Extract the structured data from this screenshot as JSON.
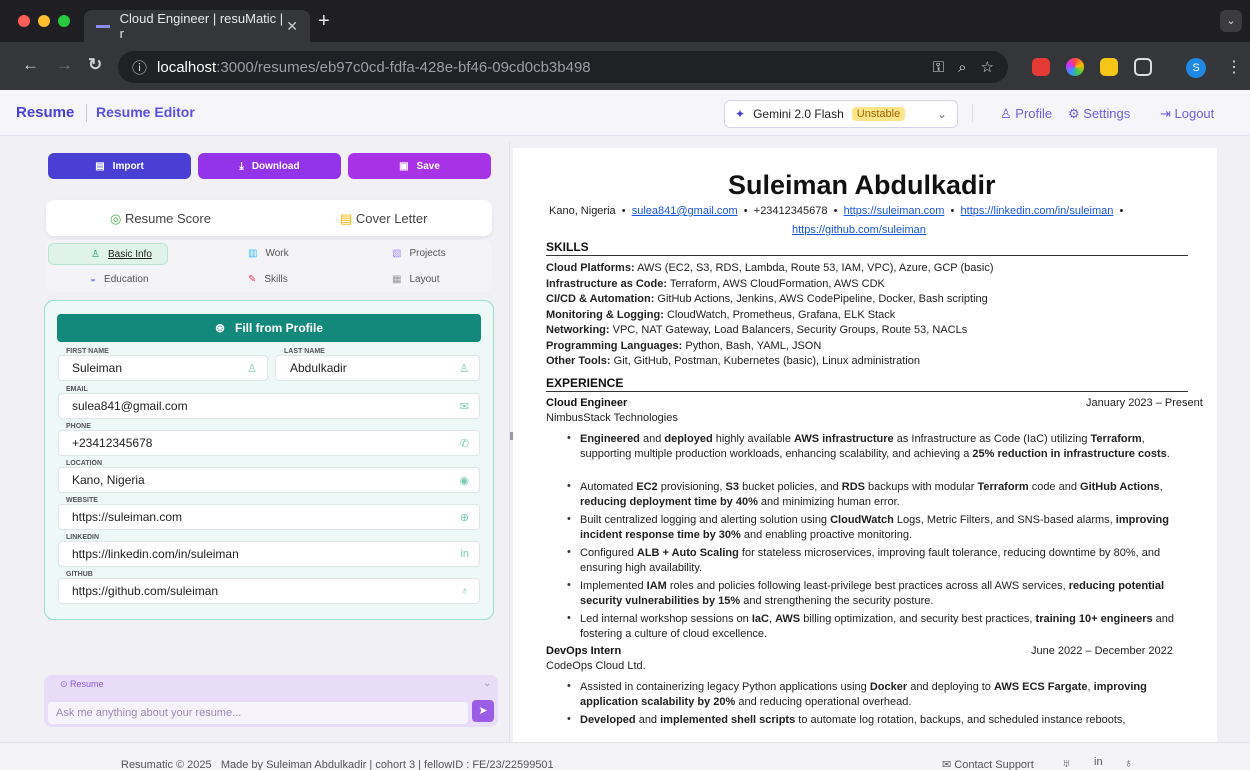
{
  "browser": {
    "tab_title": "Cloud Engineer | resuMatic | r",
    "url_host": "localhost",
    "url_rest": ":3000/resumes/eb97c0cd-fdfa-428e-bf46-09cd0cb3b498",
    "profile_initial": "S"
  },
  "header": {
    "brand": "Resume",
    "editor_label": "Resume Editor",
    "model_name": "Gemini 2.0 Flash",
    "model_tag": "Unstable",
    "profile": "Profile",
    "settings": "Settings",
    "logout": "Logout"
  },
  "actions": {
    "import": "Import",
    "download": "Download",
    "save": "Save"
  },
  "score": {
    "resume_score": "Resume Score",
    "cover_letter": "Cover Letter"
  },
  "tabs": {
    "basic": "Basic Info",
    "work": "Work",
    "projects": "Projects",
    "education": "Education",
    "skills": "Skills",
    "layout": "Layout"
  },
  "form": {
    "fill_btn": "Fill from Profile",
    "first_name_label": "FIRST NAME",
    "first_name": "Suleiman",
    "last_name_label": "LAST NAME",
    "last_name": "Abdulkadir",
    "email_label": "EMAIL",
    "email": "sulea841@gmail.com",
    "phone_label": "PHONE",
    "phone": "+23412345678",
    "location_label": "LOCATION",
    "location": "Kano, Nigeria",
    "website_label": "WEBSITE",
    "website": "https://suleiman.com",
    "linkedin_label": "LINKEDIN",
    "linkedin": "https://linkedin.com/in/suleiman",
    "github_label": "GITHUB",
    "github": "https://github.com/suleiman"
  },
  "chat": {
    "title": "Resume",
    "placeholder": "Ask me anything about your resume..."
  },
  "resume": {
    "name": "Suleiman Abdulkadir",
    "location": "Kano, Nigeria",
    "email": "sulea841@gmail.com",
    "phone": "+23412345678",
    "website": "https://suleiman.com",
    "linkedin": "https://linkedin.com/in/suleiman",
    "github": "https://github.com/suleiman",
    "skills_heading": "SKILLS",
    "skills": [
      {
        "label": "Cloud Platforms:",
        "text": " AWS (EC2, S3, RDS, Lambda, Route 53, IAM, VPC), Azure, GCP (basic)"
      },
      {
        "label": "Infrastructure as Code:",
        "text": " Terraform, AWS CloudFormation, AWS CDK"
      },
      {
        "label": "CI/CD & Automation:",
        "text": " GitHub Actions, Jenkins, AWS CodePipeline, Docker, Bash scripting"
      },
      {
        "label": "Monitoring & Logging:",
        "text": " CloudWatch, Prometheus, Grafana, ELK Stack"
      },
      {
        "label": "Networking:",
        "text": " VPC, NAT Gateway, Load Balancers, Security Groups, Route 53, NACLs"
      },
      {
        "label": "Programming Languages:",
        "text": " Python, Bash, YAML, JSON"
      },
      {
        "label": "Other Tools:",
        "text": " Git, GitHub, Postman, Kubernetes (basic), Linux administration"
      }
    ],
    "experience_heading": "EXPERIENCE",
    "job1": {
      "title": "Cloud Engineer",
      "dates": "January 2023 – Present",
      "company": "NimbusStack Technologies",
      "bullets": [
        "<b>Engineered</b> and <b>deployed</b> highly available <b>AWS infrastructure</b> as Infrastructure as Code (IaC) utilizing <b>Terraform</b>, supporting multiple production workloads, enhancing scalability, and achieving a <b>25% reduction in infrastructure costs</b>.",
        "Automated <b>EC2</b> provisioning, <b>S3</b> bucket policies, and <b>RDS</b> backups with modular <b>Terraform</b> code and <b>GitHub Actions</b>, <b>reducing deployment time by 40%</b> and minimizing human error.",
        "Built centralized logging and alerting solution using <b>CloudWatch</b> Logs, Metric Filters, and SNS-based alarms, <b>improving incident response time by 30%</b> and enabling proactive monitoring.",
        "Configured <b>ALB + Auto Scaling</b> for stateless microservices, improving fault tolerance, reducing downtime by 80%, and ensuring high availability.",
        "Implemented <b>IAM</b> roles and policies following least-privilege best practices across all AWS services, <b>reducing potential security vulnerabilities by 15%</b> and strengthening the security posture.",
        "Led internal workshop sessions on <b>IaC</b>, <b>AWS</b> billing optimization, and security best practices, <b>training 10+ engineers</b> and fostering a culture of cloud excellence."
      ]
    },
    "job2": {
      "title": "DevOps Intern",
      "dates": "June 2022 – December 2022",
      "company": "CodeOps Cloud Ltd.",
      "bullets": [
        "Assisted in containerizing legacy Python applications using <b>Docker</b> and deploying to <b>AWS ECS Fargate</b>, <b>improving application scalability by 20%</b> and reducing operational overhead.",
        "<b>Developed</b> and <b>implemented shell scripts</b> to automate log rotation, backups, and scheduled instance reboots,"
      ]
    }
  },
  "footer": {
    "text": "Resumatic © 2025   Made by Suleiman Abdulkadir | cohort 3 | fellowID : FE/23/22599501",
    "support": "Contact Support"
  },
  "colors": {
    "accent": "#5b4fe0",
    "teal": "#12897a",
    "purple": "#9b3fe0"
  }
}
